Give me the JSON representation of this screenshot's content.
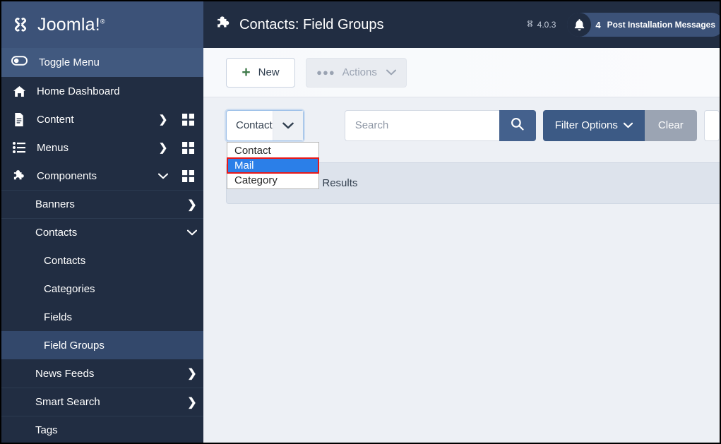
{
  "brand": {
    "name": "Joomla!",
    "logo_icon": "joomla-logo-icon"
  },
  "sidebar": {
    "toggle": {
      "label": "Toggle Menu",
      "icon": "toggle-switch-icon"
    },
    "items": [
      {
        "label": "Home Dashboard",
        "icon": "home-icon",
        "chevron": "",
        "grid": false
      },
      {
        "label": "Content",
        "icon": "document-icon",
        "chevron": "❯",
        "grid": true
      },
      {
        "label": "Menus",
        "icon": "list-icon",
        "chevron": "❯",
        "grid": true
      },
      {
        "label": "Components",
        "icon": "puzzle-icon",
        "chevron": "⌄",
        "grid": true
      }
    ],
    "subitems": [
      {
        "label": "Banners",
        "chevron": "❯",
        "active": false,
        "level": 2
      },
      {
        "label": "Contacts",
        "chevron": "⌄",
        "active": false,
        "level": 2
      },
      {
        "label": "Contacts",
        "chevron": "",
        "active": false,
        "level": 3
      },
      {
        "label": "Categories",
        "chevron": "",
        "active": false,
        "level": 3
      },
      {
        "label": "Fields",
        "chevron": "",
        "active": false,
        "level": 3
      },
      {
        "label": "Field Groups",
        "chevron": "",
        "active": true,
        "level": 3
      },
      {
        "label": "News Feeds",
        "chevron": "❯",
        "active": false,
        "level": 2
      },
      {
        "label": "Smart Search",
        "chevron": "❯",
        "active": false,
        "level": 2
      },
      {
        "label": "Tags",
        "chevron": "",
        "active": false,
        "level": 2
      }
    ]
  },
  "header": {
    "title": "Contacts: Field Groups",
    "title_icon": "puzzle-icon",
    "version": "4.0.3",
    "version_icon": "joomla-mark-icon",
    "messages": {
      "count": "4",
      "label": "Post Installation Messages",
      "icon": "bell-icon"
    }
  },
  "toolbar": {
    "new_label": "New",
    "new_icon": "plus-icon",
    "actions_label": "Actions",
    "actions_icon": "ellipsis-icon",
    "actions_chevron_icon": "chevron-down-icon",
    "actions_disabled": true
  },
  "filters": {
    "context_select": {
      "value": "Contact",
      "expanded": true,
      "chevron_icon": "chevron-down-icon",
      "options": [
        {
          "label": "Contact",
          "selected": false
        },
        {
          "label": "Mail",
          "selected": true
        },
        {
          "label": "Category",
          "selected": false
        }
      ]
    },
    "search": {
      "value": "",
      "placeholder": "Search",
      "button_icon": "search-icon"
    },
    "filter_options_label": "Filter Options",
    "filter_options_icon": "chevron-down-icon",
    "clear_label": "Clear"
  },
  "alert": {
    "message": "No Matching Results",
    "icon": "info-circle-icon"
  },
  "colors": {
    "sidebar_bg": "#212d42",
    "brand_bg": "#3c5278",
    "toggle_bg": "#41597f",
    "active_sub": "#33486b",
    "content_bg": "#edf0f5",
    "primary_btn": "#3c5a85",
    "search_btn": "#44618d",
    "clear_btn": "#9ba4b3",
    "alert_bg": "#dde3ec",
    "option_selected_bg": "#2b7fe8",
    "option_outline": "#e81818",
    "plus_green": "#3f7a4a"
  }
}
